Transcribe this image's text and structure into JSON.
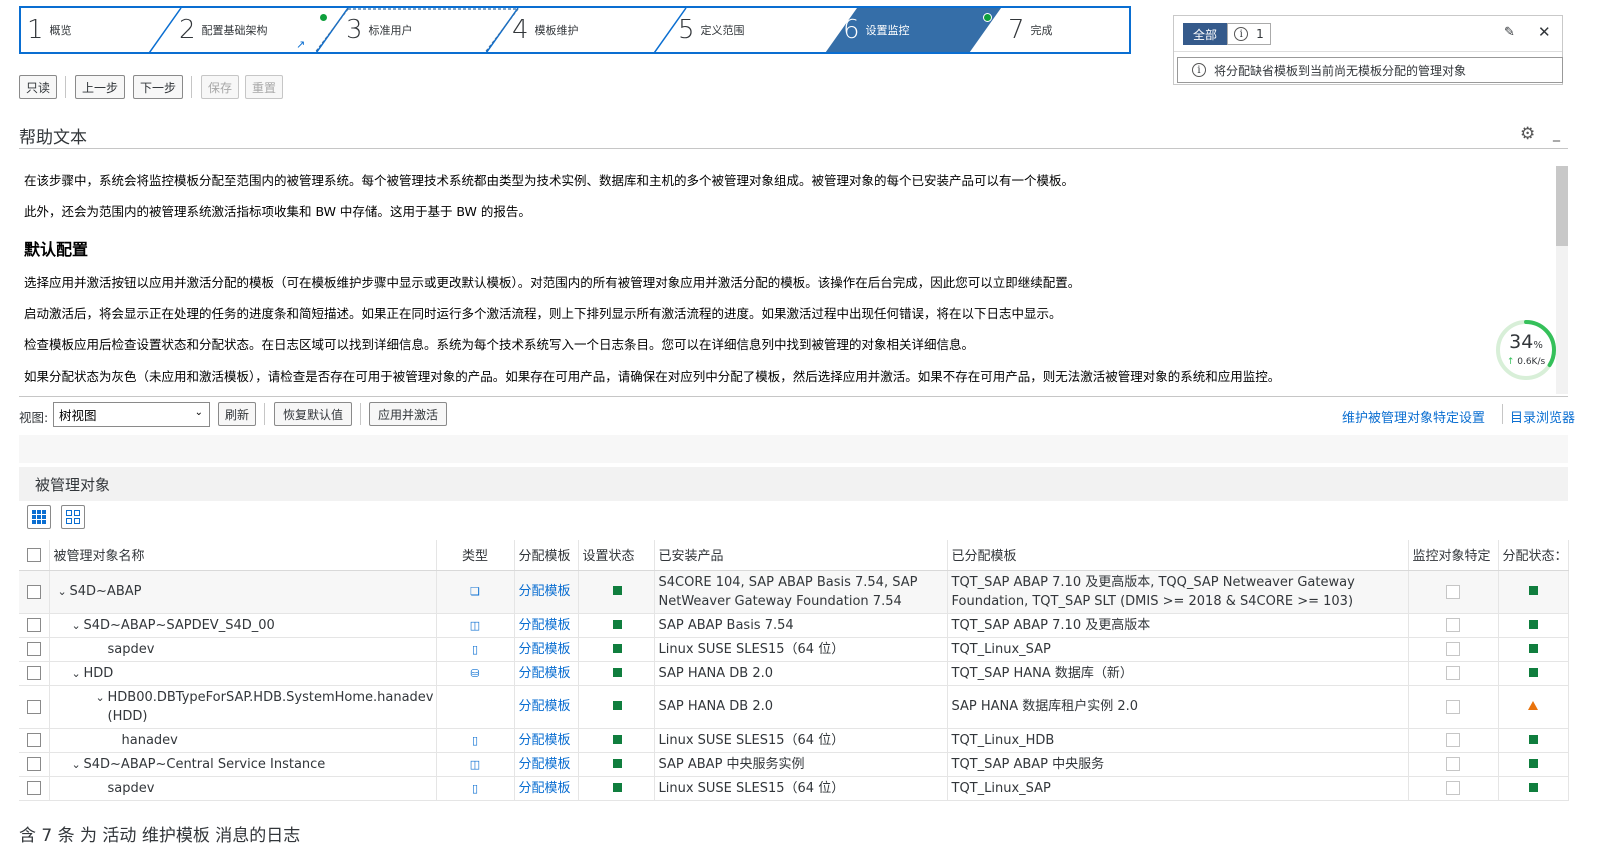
{
  "wizard": {
    "steps": [
      {
        "num": "1",
        "label": "概览"
      },
      {
        "num": "2",
        "label": "配置基础架构"
      },
      {
        "num": "3",
        "label": "标准用户"
      },
      {
        "num": "4",
        "label": "模板维护"
      },
      {
        "num": "5",
        "label": "定义范围"
      },
      {
        "num": "6",
        "label": "设置监控"
      },
      {
        "num": "7",
        "label": "完成"
      }
    ],
    "active_step": 6,
    "accent": "#0a6ed1",
    "active_color": "#356ea8"
  },
  "messages": {
    "all_label": "全部",
    "info_count": "1",
    "items": [
      "将分配缺省模板到当前尚无模板分配的管理对象"
    ]
  },
  "toolbar": {
    "readonly": "只读",
    "prev": "上一步",
    "next": "下一步",
    "save": "保存",
    "reset": "重置"
  },
  "help": {
    "title": "帮助文本",
    "p1": "在该步骤中，系统会将监控模板分配至范围内的被管理系统。每个被管理技术系统都由类型为技术实例、数据库和主机的多个被管理对象组成。被管理对象的每个已安装产品可以有一个模板。",
    "p2": "此外，还会为范围内的被管理系统激活指标项收集和 BW 中存储。这用于基于 BW 的报告。",
    "heading": "默认配置",
    "p3": "选择应用并激活按钮以应用并激活分配的模板（可在模板维护步骤中显示或更改默认模板）。对范围内的所有被管理对象应用并激活分配的模板。该操作在后台完成，因此您可以立即继续配置。",
    "p4": "启动激活后，将会显示正在处理的任务的进度条和简短描述。如果正在同时运行多个激活流程，则上下排列显示所有激活流程的进度。如果激活过程中出现任何错误，将在以下日志中显示。",
    "p5": "检查模板应用后检查设置状态和分配状态。在日志区域可以找到详细信息。系统为每个技术系统写入一个日志条目。您可以在详细信息列中找到被管理的对象相关详细信息。",
    "p6": "如果分配状态为灰色（未应用和激活模板），请检查是否存在可用于被管理对象的产品。如果存在可用产品，请确保在对应列中分配了模板，然后选择应用并激活。如果不存在可用产品，则无法激活被管理对象的系统和应用监控。"
  },
  "monitor": {
    "percent": "34",
    "percent_sign": "%",
    "rate": "0.6K/s",
    "progress": 0.34
  },
  "viewbar": {
    "view_label": "视图:",
    "view_value": "树视图",
    "refresh": "刷新",
    "restore": "恢复默认值",
    "apply": "应用并激活",
    "link1": "维护被管理对象特定设置",
    "link2": "目录浏览器"
  },
  "managed": {
    "title": "被管理对象",
    "columns": [
      "被管理对象名称",
      "类型",
      "分配模板",
      "设置状态",
      "已安装产品",
      "已分配模板",
      "监控对象特定",
      "分配状态："
    ],
    "rows": [
      {
        "name": "S4D~ABAP",
        "level": 0,
        "expanded": true,
        "type_icon": "system-icon",
        "assign": "分配模板",
        "setup": "green",
        "product": "S4CORE 104, SAP ABAP Basis 7.54, SAP",
        "product2": "NetWeaver Gateway Foundation 7.54",
        "template": "TQT_SAP ABAP 7.10 及更高版本, TQQ_SAP Netweaver Gateway",
        "template2": "Foundation, TQT_SAP SLT (DMIS >= 2018 & S4CORE >= 103)",
        "status": "green"
      },
      {
        "name": "S4D~ABAP~SAPDEV_S4D_00",
        "level": 1,
        "expanded": true,
        "type_icon": "instance-icon",
        "assign": "分配模板",
        "setup": "green",
        "product": "SAP ABAP Basis 7.54",
        "product2": "",
        "template": "TQT_SAP ABAP 7.10 及更高版本",
        "template2": "",
        "status": "green"
      },
      {
        "name": "sapdev",
        "level": 2,
        "expanded": false,
        "type_icon": "host-icon",
        "assign": "分配模板",
        "setup": "green",
        "product": "Linux SUSE SLES15（64 位）",
        "product2": "",
        "template": "TQT_Linux_SAP",
        "template2": "",
        "status": "green"
      },
      {
        "name": "HDD",
        "level": 1,
        "expanded": true,
        "type_icon": "database-icon",
        "assign": "分配模板",
        "setup": "green",
        "product": "SAP HANA DB 2.0",
        "product2": "",
        "template": "TQT_SAP HANA 数据库（新）",
        "template2": "",
        "status": "green"
      },
      {
        "name": "HDB00.DBTypeForSAP.HDB.SystemHome.hanadev",
        "name2": "(HDD)",
        "level": 2,
        "expanded": true,
        "type_icon": "",
        "assign": "分配模板",
        "setup": "green",
        "product": "SAP HANA DB 2.0",
        "product2": "",
        "template": "SAP HANA 数据库租户实例 2.0",
        "template2": "",
        "status": "warning"
      },
      {
        "name": "hanadev",
        "level": 3,
        "expanded": false,
        "type_icon": "host-icon",
        "assign": "分配模板",
        "setup": "green",
        "product": "Linux SUSE SLES15（64 位）",
        "product2": "",
        "template": "TQT_Linux_HDB",
        "template2": "",
        "status": "green"
      },
      {
        "name": "S4D~ABAP~Central Service Instance",
        "level": 1,
        "expanded": true,
        "type_icon": "instance-icon",
        "assign": "分配模板",
        "setup": "green",
        "product": "SAP ABAP 中央服务实例",
        "product2": "",
        "template": "TQT_SAP ABAP 中央服务",
        "template2": "",
        "status": "green"
      },
      {
        "name": "sapdev",
        "level": 2,
        "expanded": false,
        "type_icon": "host-icon",
        "assign": "分配模板",
        "setup": "green",
        "product": "Linux SUSE SLES15（64 位）",
        "product2": "",
        "template": "TQT_Linux_SAP",
        "template2": "",
        "status": "green"
      }
    ]
  },
  "log": {
    "title": "含 7 条 为 活动 维护模板 消息的日志"
  }
}
